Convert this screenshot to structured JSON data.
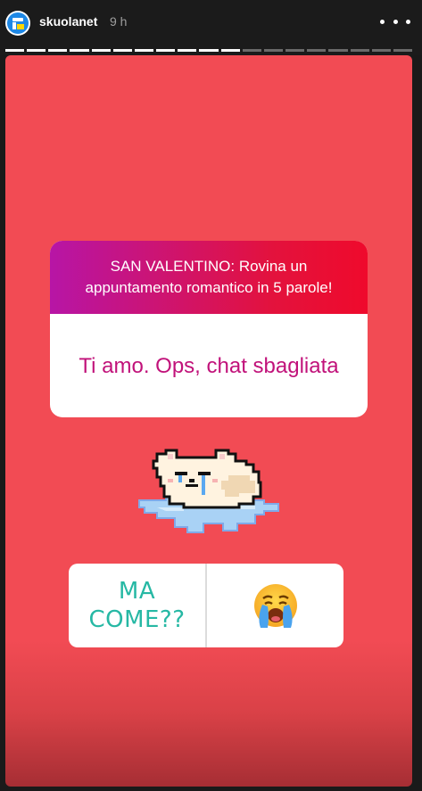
{
  "header": {
    "username": "skuolanet",
    "time": "9 h",
    "progress": {
      "segments_total": 19,
      "segments_seen": 11
    }
  },
  "question_sticker": {
    "question": "SAN VALENTINO: Rovina un appuntamento romantico in 5 parole!",
    "answer": "Ti amo. Ops, chat sbagliata"
  },
  "poll": {
    "option1": "MA COME??",
    "option2_icon": "crying-face-emoji"
  },
  "colors": {
    "background": "#f24b54",
    "question_gradient_start": "#b715a6",
    "question_gradient_end": "#ef0a2c",
    "answer_text": "#c1127a",
    "poll_text": "#26b8a4"
  }
}
